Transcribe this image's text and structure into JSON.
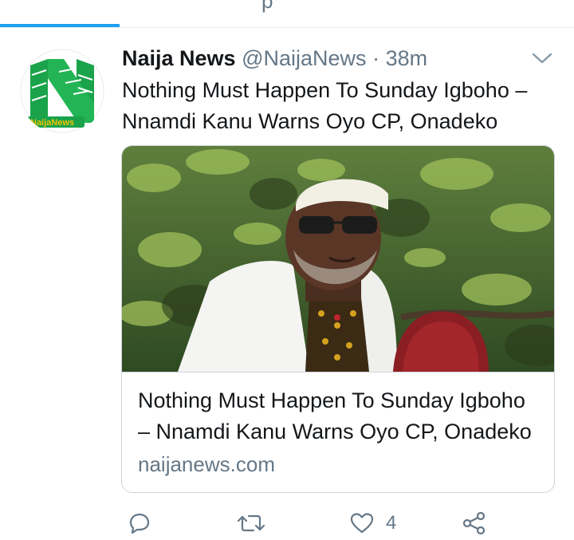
{
  "tabs": {
    "partial_label": "p"
  },
  "tweet": {
    "author_name": "Naija News",
    "handle": "@NaijaNews",
    "separator": "·",
    "time": "38m",
    "avatar_text": "NaijaNews",
    "text": "Nothing Must Happen To Sunday Igboho – Nnamdi Kanu Warns Oyo CP, Onadeko",
    "card": {
      "title": "Nothing Must Happen To Sunday Igboho – Nnamdi Kanu Warns Oyo CP, Onadeko",
      "domain": "naijanews.com"
    },
    "actions": {
      "reply_icon": "reply-icon",
      "retweet_icon": "retweet-icon",
      "like_icon": "heart-icon",
      "like_count": "4",
      "share_icon": "share-icon"
    }
  },
  "colors": {
    "accent": "#1da1f2",
    "secondary_text": "#657786",
    "brand_green": "#1aa34a"
  }
}
